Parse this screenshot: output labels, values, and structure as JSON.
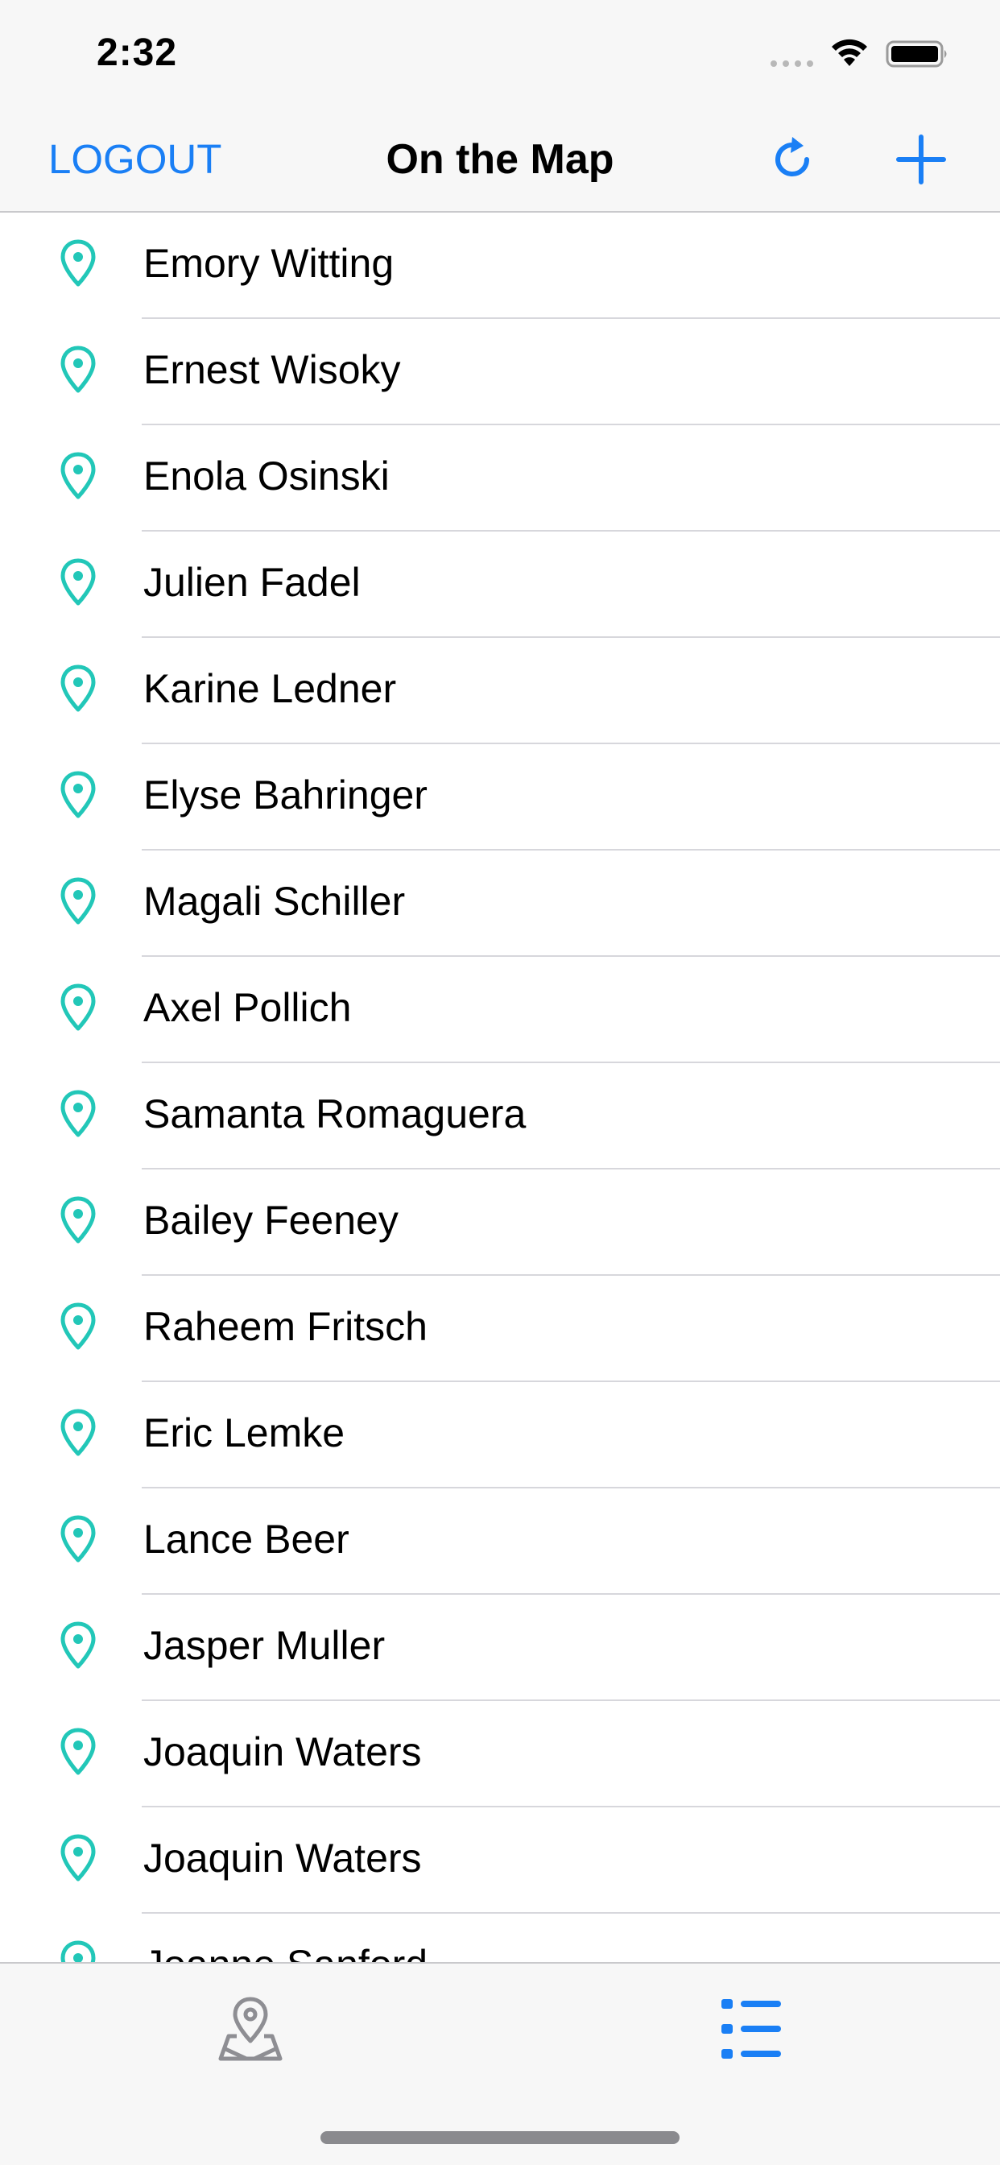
{
  "status_bar": {
    "time": "2:32"
  },
  "nav": {
    "logout_label": "LOGOUT",
    "title": "On the Map",
    "refresh_icon": "refresh-icon",
    "add_icon": "plus-icon"
  },
  "students": [
    {
      "name": "Emory Witting"
    },
    {
      "name": "Ernest Wisoky"
    },
    {
      "name": "Enola Osinski"
    },
    {
      "name": "Julien Fadel"
    },
    {
      "name": "Karine Ledner"
    },
    {
      "name": "Elyse Bahringer"
    },
    {
      "name": "Magali Schiller"
    },
    {
      "name": "Axel Pollich"
    },
    {
      "name": "Samanta Romaguera"
    },
    {
      "name": "Bailey Feeney"
    },
    {
      "name": "Raheem Fritsch"
    },
    {
      "name": "Eric Lemke"
    },
    {
      "name": "Lance Beer"
    },
    {
      "name": "Jasper Muller"
    },
    {
      "name": "Joaquin Waters"
    },
    {
      "name": "Joaquin Waters"
    },
    {
      "name": "Joanne Sanford"
    }
  ],
  "tabs": [
    {
      "icon": "map-pin-icon",
      "selected": false
    },
    {
      "icon": "list-icon",
      "selected": true
    }
  ],
  "colors": {
    "accent": "#1a7ff5",
    "pin": "#22c7b8",
    "tab_inactive": "#8e8e93"
  }
}
